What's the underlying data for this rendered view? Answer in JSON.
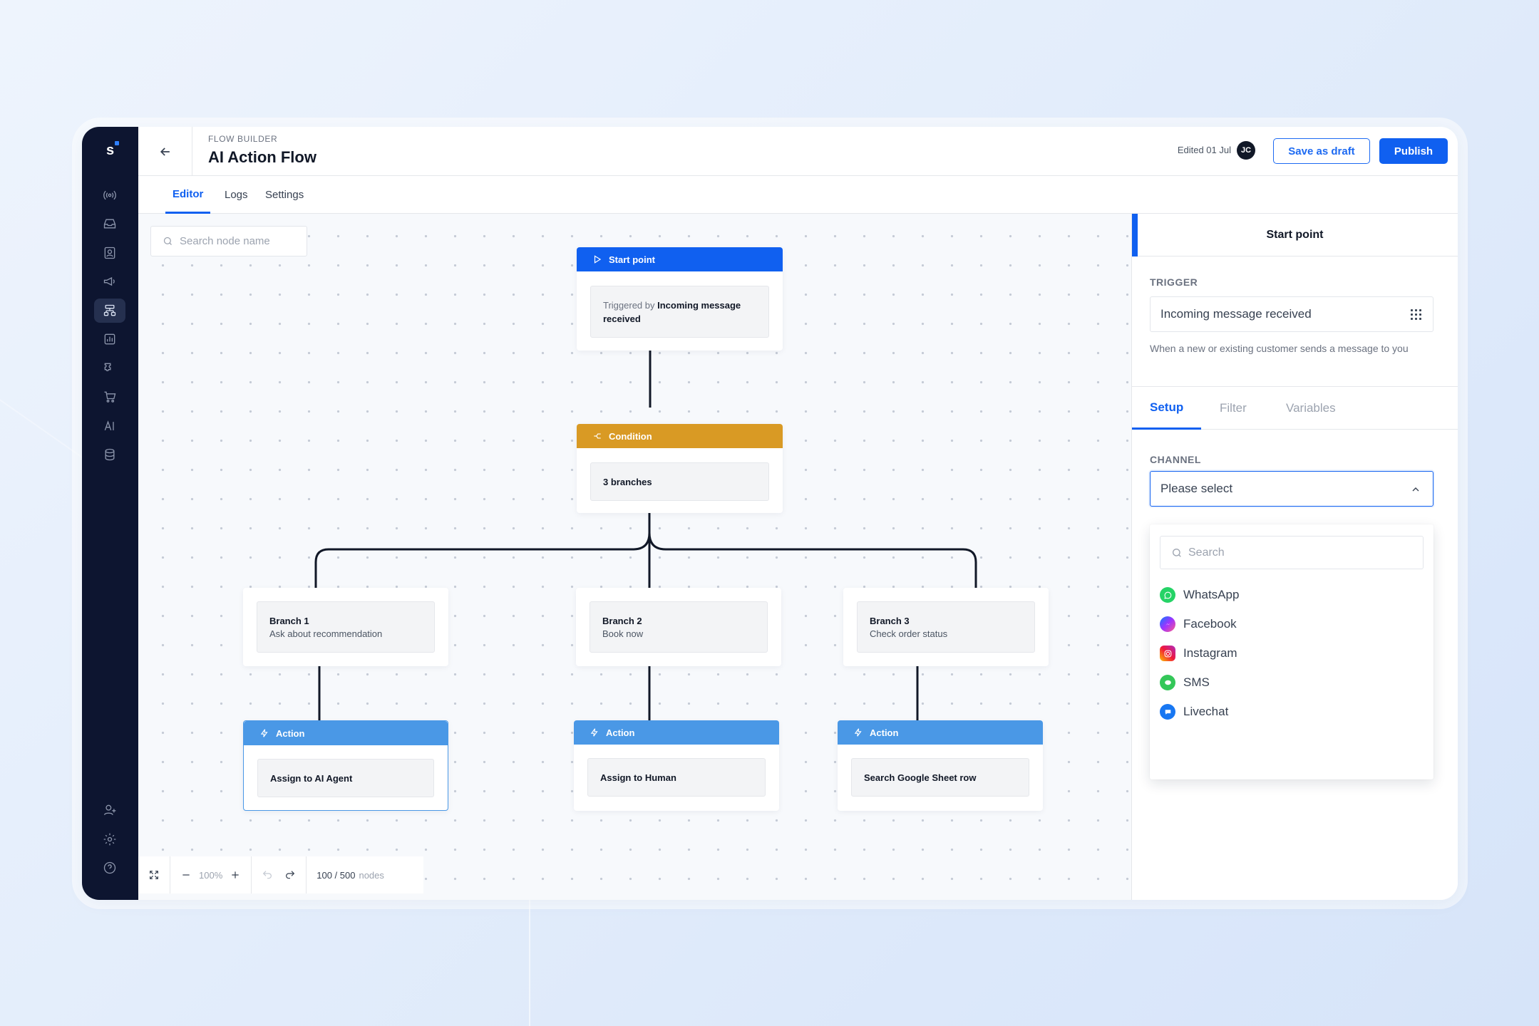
{
  "app": {
    "logo_text": "s"
  },
  "header": {
    "breadcrumb": "FLOW BUILDER",
    "title": "AI Action Flow",
    "edited": "Edited 01 Jul",
    "avatar_initials": "JC",
    "save_draft_label": "Save as draft",
    "publish_label": "Publish"
  },
  "tabs": [
    {
      "label": "Editor",
      "active": true
    },
    {
      "label": "Logs",
      "active": false
    },
    {
      "label": "Settings",
      "active": false
    }
  ],
  "canvas": {
    "search_placeholder": "Search node name",
    "start_node": {
      "header": "Start point",
      "triggered_prefix": "Triggered by",
      "trigger": "Incoming message received"
    },
    "condition_node": {
      "header": "Condition",
      "body": "3 branches"
    },
    "branches": [
      {
        "title": "Branch 1",
        "subtitle": "Ask about recommendation"
      },
      {
        "title": "Branch 2",
        "subtitle": "Book now"
      },
      {
        "title": "Branch 3",
        "subtitle": "Check order status"
      }
    ],
    "actions": [
      {
        "header": "Action",
        "body": "Assign to AI Agent"
      },
      {
        "header": "Action",
        "body": "Assign to Human"
      },
      {
        "header": "Action",
        "body": "Search Google Sheet row"
      }
    ],
    "toolbar": {
      "zoom": "100%",
      "node_count": "100 / 500",
      "node_unit": "nodes"
    }
  },
  "panel": {
    "title": "Start point",
    "trigger_label": "TRIGGER",
    "trigger_value": "Incoming message received",
    "trigger_help": "When a new or existing customer sends a message to you",
    "tabs": [
      {
        "label": "Setup",
        "active": true
      },
      {
        "label": "Filter",
        "active": false
      },
      {
        "label": "Variables",
        "active": false
      }
    ],
    "channel_label": "CHANNEL",
    "channel_placeholder": "Please select",
    "dropdown_search_placeholder": "Search",
    "channels": [
      {
        "label": "WhatsApp",
        "icon": "whatsapp-icon",
        "color": "#25d366"
      },
      {
        "label": "Facebook",
        "icon": "messenger-icon",
        "color": "#8a3cf5"
      },
      {
        "label": "Instagram",
        "icon": "instagram-icon",
        "color": "#e1306c"
      },
      {
        "label": "SMS",
        "icon": "sms-icon",
        "color": "#34c759"
      },
      {
        "label": "Livechat",
        "icon": "livechat-icon",
        "color": "#1877f2"
      }
    ]
  },
  "colors": {
    "primary": "#1060f0",
    "start_header": "#1060f0",
    "condition_header": "#d99a24",
    "action_header": "#4a98e6",
    "sidebar": "#0d1530"
  }
}
